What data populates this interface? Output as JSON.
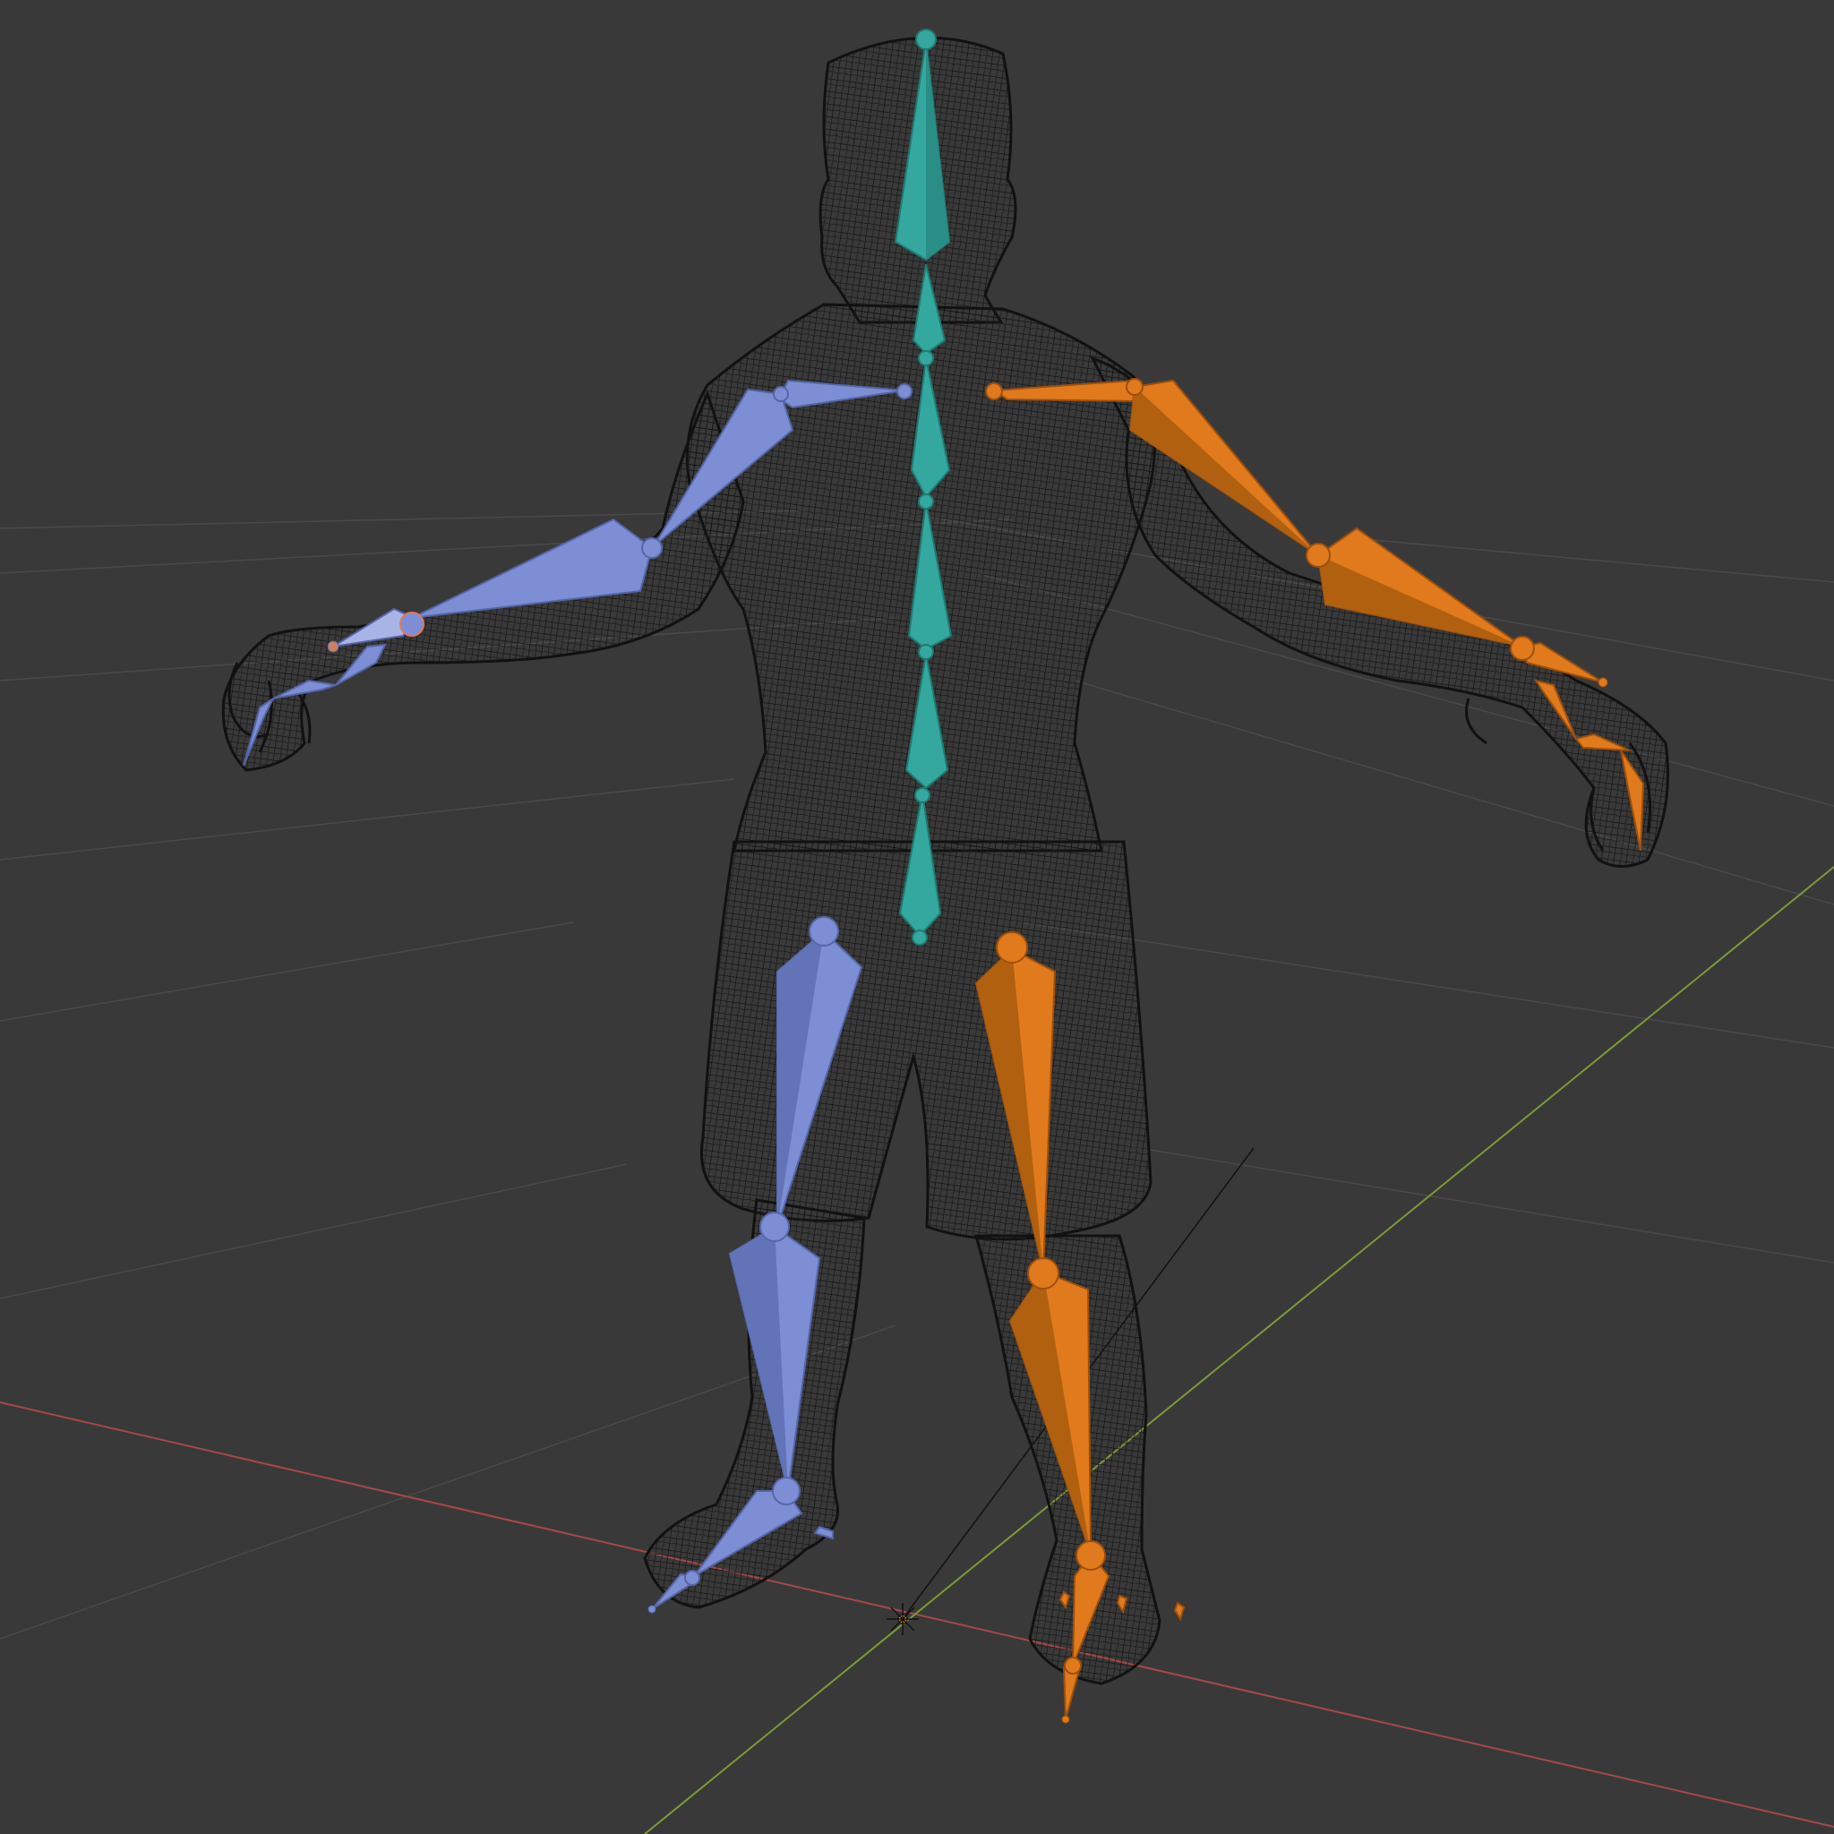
{
  "viewport": {
    "mode": "wireframe",
    "colors": {
      "background": "#393939",
      "grid": "#4a4a4a",
      "x_axis": "#a84848",
      "y_axis": "#7a9a38",
      "wireframe": "#121212",
      "bone_center": "#34a89e",
      "bone_center_dark": "#1f7a72",
      "bone_left": "#7d8ed4",
      "bone_left_dark": "#5565a8",
      "bone_right": "#e07a1c",
      "bone_right_dark": "#9e4f0c",
      "origin_marker": "#e08a2a"
    }
  },
  "armature": {
    "name_icon": "armature-icon",
    "chains": [
      {
        "id": "spine",
        "color_key": "center"
      },
      {
        "id": "left-arm",
        "color_key": "left"
      },
      {
        "id": "right-arm",
        "color_key": "right"
      },
      {
        "id": "left-leg",
        "color_key": "left"
      },
      {
        "id": "right-leg",
        "color_key": "right"
      }
    ]
  }
}
